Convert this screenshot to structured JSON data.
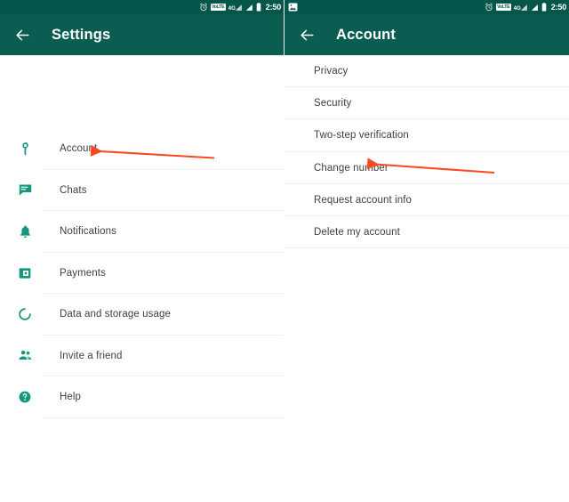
{
  "screens": [
    {
      "key": "settings",
      "status_bar": {
        "left_icons": [],
        "right_icons": [
          "alarm-clock-icon",
          "volte-badge",
          "network-4g-signal-icon",
          "signal-bars-icon",
          "battery-icon"
        ],
        "volte_text": "VoLTE",
        "network_text": "4G",
        "time": "2:50"
      },
      "appbar": {
        "back_label": "back-arrow",
        "title": "Settings"
      },
      "items": [
        {
          "icon": "key-icon",
          "label": "Account"
        },
        {
          "icon": "chat-bubble-icon",
          "label": "Chats"
        },
        {
          "icon": "bell-icon",
          "label": "Notifications"
        },
        {
          "icon": "payment-card-icon",
          "label": "Payments"
        },
        {
          "icon": "data-usage-circle-icon",
          "label": "Data and storage usage"
        },
        {
          "icon": "people-icon",
          "label": "Invite a friend"
        },
        {
          "icon": "help-question-icon",
          "label": "Help"
        }
      ]
    },
    {
      "key": "account",
      "status_bar": {
        "left_icons": [
          "screenshot-image-icon"
        ],
        "right_icons": [
          "alarm-clock-icon",
          "volte-badge",
          "network-4g-signal-icon",
          "signal-bars-icon",
          "battery-icon"
        ],
        "volte_text": "VoLTE",
        "network_text": "4G",
        "time": "2:50"
      },
      "appbar": {
        "back_label": "back-arrow",
        "title": "Account"
      },
      "items": [
        {
          "label": "Privacy"
        },
        {
          "label": "Security"
        },
        {
          "label": "Two-step verification"
        },
        {
          "label": "Change number"
        },
        {
          "label": "Request account info"
        },
        {
          "label": "Delete my account"
        }
      ]
    }
  ],
  "annotations": [
    {
      "name": "arrow-to-account",
      "target": "Account",
      "color": "#fb4a22"
    },
    {
      "name": "arrow-to-change-number",
      "target": "Change number",
      "color": "#fb4a22"
    }
  ],
  "colors": {
    "status_bar": "#04564b",
    "app_bar": "#0b5d51",
    "accent_teal": "#0f9b81",
    "icon_teal": "#13987f",
    "text": "#3f3f3f",
    "divider": "#f1f1f1",
    "arrow": "#fb4a22",
    "background": "#ffffff"
  }
}
